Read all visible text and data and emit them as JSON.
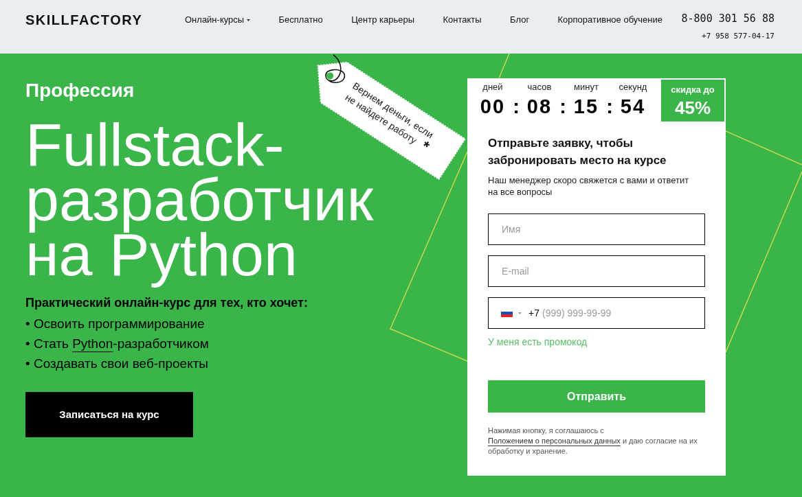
{
  "header": {
    "logo": "SKILLFACTORY",
    "nav": [
      {
        "label": "Онлайн-курсы",
        "dropdown": true
      },
      {
        "label": "Бесплатно",
        "dropdown": false
      },
      {
        "label": "Центр карьеры",
        "dropdown": false
      },
      {
        "label": "Контакты",
        "dropdown": false
      },
      {
        "label": "Блог",
        "dropdown": false
      },
      {
        "label": "Корпоративное обучение",
        "dropdown": false
      }
    ],
    "phones": [
      "8-800 301 56 88",
      "+7 958 577-04-17"
    ]
  },
  "hero": {
    "eyebrow": "Профессия",
    "title_lines": [
      "Fullstack-",
      "разработчик",
      "на Python"
    ],
    "subtitle": "Практический онлайн-курс для тех, кто хочет:",
    "bullets": [
      {
        "text": "• Освоить программирование"
      },
      {
        "text": "• Стать ",
        "link": "Python",
        "after": "-разработчиком"
      },
      {
        "text": "• Создавать свои веб-проекты"
      }
    ],
    "cta": "Записаться на курс",
    "tag": {
      "text": "Вернем деньги, если не найдете работу",
      "mark": "*"
    }
  },
  "form": {
    "timer": {
      "units": [
        {
          "label": "дней",
          "value": "00"
        },
        {
          "label": "часов",
          "value": "08"
        },
        {
          "label": "минут",
          "value": "15"
        },
        {
          "label": "секунд",
          "value": "54"
        }
      ],
      "separators": [
        ":",
        ":",
        ":"
      ]
    },
    "discount": {
      "label": "скидка до",
      "value": "45%"
    },
    "title": "Отправьте заявку, чтобы забронировать место на курсе",
    "description": "Наш менеджер скоро свяжется с вами и ответит на все вопросы",
    "fields": [
      {
        "kind": "text",
        "placeholder": "Имя"
      },
      {
        "kind": "text",
        "placeholder": "E-mail"
      },
      {
        "kind": "phone",
        "prefix": "+7",
        "placeholder": "(999) 999-99-99"
      }
    ],
    "promo_link": "У меня есть промокод",
    "submit": "Отправить",
    "consent": {
      "before": "Нажимая кнопку, я соглашаюсь с ",
      "link": "Положением о персональных данных",
      "after": " и даю согласие на их обработку и хранение."
    }
  }
}
